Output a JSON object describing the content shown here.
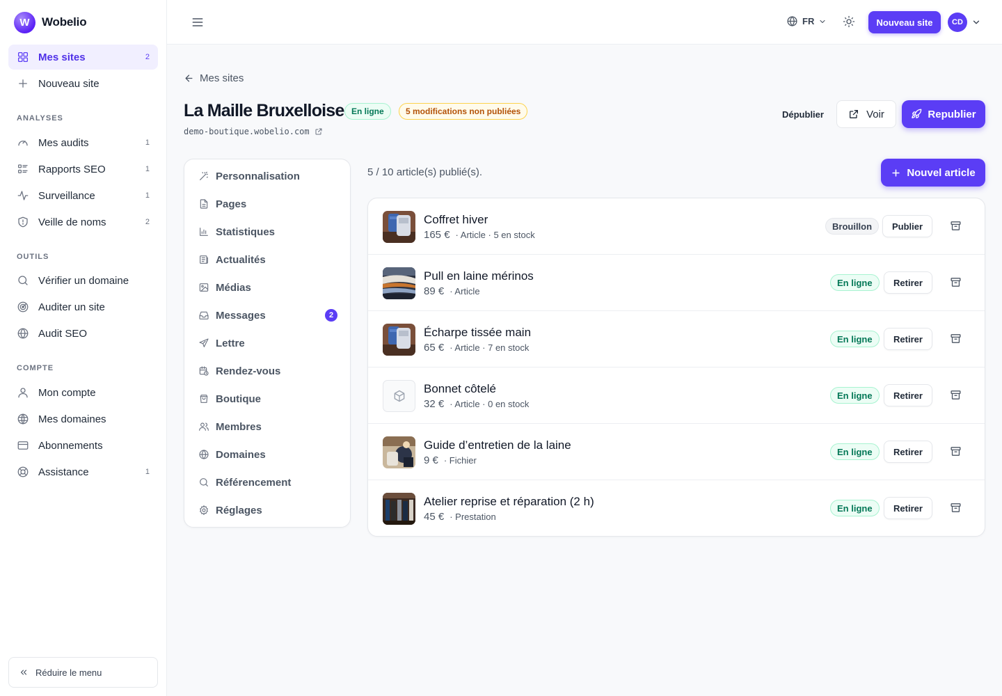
{
  "sidebar": {
    "brand": "Wobelio",
    "brand_initial": "W",
    "primary": [
      {
        "label": "Mes sites",
        "count": "2",
        "icon": "grid-icon",
        "active": true
      },
      {
        "label": "Nouveau site",
        "count": "",
        "icon": "plus-icon",
        "active": false
      }
    ],
    "sections": [
      {
        "title": "ANALYSES",
        "items": [
          {
            "label": "Mes audits",
            "count": "1",
            "icon": "gauge-icon"
          },
          {
            "label": "Rapports SEO",
            "count": "1",
            "icon": "report-list-icon"
          },
          {
            "label": "Surveillance",
            "count": "1",
            "icon": "activity-icon"
          },
          {
            "label": "Veille de noms",
            "count": "2",
            "icon": "shield-icon"
          }
        ]
      },
      {
        "title": "OUTILS",
        "items": [
          {
            "label": "Vérifier un domaine",
            "count": "",
            "icon": "search-icon"
          },
          {
            "label": "Auditer un site",
            "count": "",
            "icon": "radar-icon"
          },
          {
            "label": "Audit SEO",
            "count": "",
            "icon": "globe-icon"
          }
        ]
      },
      {
        "title": "COMPTE",
        "items": [
          {
            "label": "Mon compte",
            "count": "",
            "icon": "user-icon"
          },
          {
            "label": "Mes domaines",
            "count": "",
            "icon": "globe-grid-icon"
          },
          {
            "label": "Abonnements",
            "count": "",
            "icon": "credit-card-icon"
          },
          {
            "label": "Assistance",
            "count": "1",
            "icon": "lifebuoy-icon"
          }
        ]
      }
    ],
    "collapse_label": "Réduire le menu"
  },
  "topbar": {
    "language": "FR",
    "new_site_label": "Nouveau site",
    "avatar_initials": "CD"
  },
  "header": {
    "back_label": "Mes sites",
    "title": "La Maille Bruxelloise",
    "status_badge": "En ligne",
    "changes_badge": "5 modifications non publiées",
    "url": "demo-boutique.wobelio.com",
    "depublish_label": "Dépublier",
    "view_label": "Voir",
    "republish_label": "Republier"
  },
  "subnav": [
    {
      "label": "Personnalisation",
      "icon": "magic-wand-icon"
    },
    {
      "label": "Pages",
      "icon": "file-icon"
    },
    {
      "label": "Statistiques",
      "icon": "bar-chart-icon"
    },
    {
      "label": "Actualités",
      "icon": "newspaper-icon"
    },
    {
      "label": "Médias",
      "icon": "image-icon"
    },
    {
      "label": "Messages",
      "icon": "inbox-icon",
      "badge": "2"
    },
    {
      "label": "Lettre",
      "icon": "send-icon"
    },
    {
      "label": "Rendez-vous",
      "icon": "calendar-clock-icon"
    },
    {
      "label": "Boutique",
      "icon": "shopping-bag-icon"
    },
    {
      "label": "Membres",
      "icon": "users-icon"
    },
    {
      "label": "Domaines",
      "icon": "globe-icon"
    },
    {
      "label": "Référencement",
      "icon": "search-icon"
    },
    {
      "label": "Réglages",
      "icon": "gear-icon"
    }
  ],
  "articles": {
    "summary": "5 / 10 article(s) publié(s).",
    "new_label": "Nouvel article",
    "items": [
      {
        "name": "Coffret hiver",
        "price": "165 €",
        "details": "· Article · 5 en stock",
        "status": "Brouillon",
        "status_type": "draft",
        "action": "Publier",
        "thumb": "sweaters"
      },
      {
        "name": "Pull en laine mérinos",
        "price": "89 €",
        "details": "· Article",
        "status": "En ligne",
        "status_type": "online",
        "action": "Retirer",
        "thumb": "wool"
      },
      {
        "name": "Écharpe tissée main",
        "price": "65 €",
        "details": "· Article · 7 en stock",
        "status": "En ligne",
        "status_type": "online",
        "action": "Retirer",
        "thumb": "sweaters"
      },
      {
        "name": "Bonnet côtelé",
        "price": "32 €",
        "details": "· Article · 0 en stock",
        "status": "En ligne",
        "status_type": "online",
        "action": "Retirer",
        "thumb": "placeholder"
      },
      {
        "name": "Guide d’entretien de la laine",
        "price": "9 €",
        "details": "· Fichier",
        "status": "En ligne",
        "status_type": "online",
        "action": "Retirer",
        "thumb": "guide"
      },
      {
        "name": "Atelier reprise et réparation (2 h)",
        "price": "45 €",
        "details": "· Prestation",
        "status": "En ligne",
        "status_type": "online",
        "action": "Retirer",
        "thumb": "shop"
      }
    ]
  },
  "colors": {
    "accent": "#5b3df5",
    "online_text": "#047857",
    "online_bg": "#ecfdf5",
    "warning_text": "#b45309",
    "warning_bg": "#fffbeb"
  }
}
